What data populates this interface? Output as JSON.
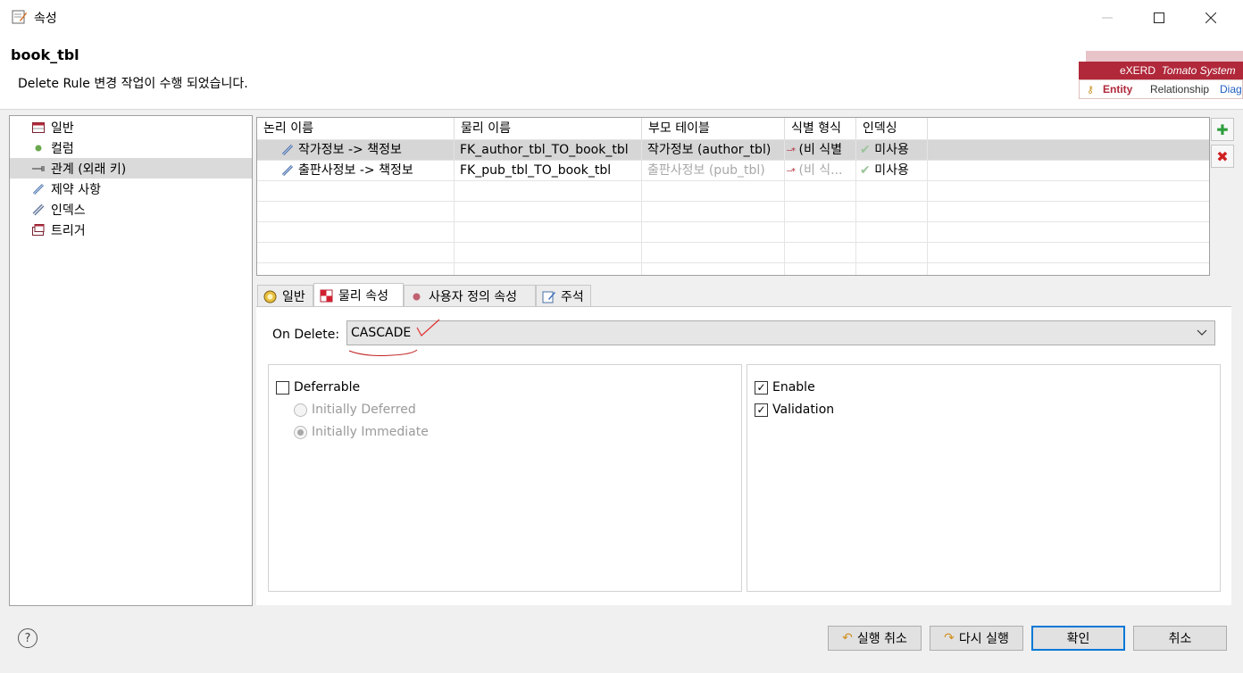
{
  "window": {
    "title": "속성"
  },
  "header": {
    "title": "book_tbl",
    "message": "Delete Rule 변경 작업이 수행 되었습니다."
  },
  "logo": {
    "brand": "eXERD",
    "product": "Tomato System",
    "tabs": [
      "Entity",
      "Relationship",
      "Diag"
    ]
  },
  "nav": {
    "items": [
      {
        "label": "일반",
        "icon": "table-icon"
      },
      {
        "label": "컬럼",
        "icon": "column-dot-icon"
      },
      {
        "label": "관계 (외래 키)",
        "icon": "relation-arrow-icon",
        "selected": true
      },
      {
        "label": "제약 사항",
        "icon": "constraint-icon"
      },
      {
        "label": "인덱스",
        "icon": "index-icon"
      },
      {
        "label": "트리거",
        "icon": "trigger-icon"
      }
    ]
  },
  "table": {
    "headers": [
      "논리 이름",
      "물리 이름",
      "부모 테이블",
      "식별 형식",
      "인덱싱"
    ],
    "rows": [
      {
        "logical": "작가정보 -> 책정보",
        "physical": "FK_author_tbl_TO_book_tbl",
        "parent": "작가정보 (author_tbl)",
        "ident": "(비 식별",
        "indexing": "미사용",
        "selected": true
      },
      {
        "logical": "출판사정보 -> 책정보",
        "physical": "FK_pub_tbl_TO_book_tbl",
        "parent": "출판사정보 (pub_tbl)",
        "ident": "(비 식...",
        "indexing": "미사용",
        "selected": false
      }
    ]
  },
  "tabs": [
    {
      "label": "일반",
      "icon": "general-icon"
    },
    {
      "label": "물리 속성",
      "icon": "physical-icon",
      "active": true
    },
    {
      "label": "사용자 정의 속성",
      "icon": "user-prop-icon"
    },
    {
      "label": "주석",
      "icon": "comment-icon"
    }
  ],
  "physical": {
    "on_delete_label": "On Delete:",
    "on_delete_value": "CASCADE",
    "deferrable": {
      "label": "Deferrable",
      "checked": false
    },
    "initially_deferred": {
      "label": "Initially Deferred",
      "selected": false
    },
    "initially_immediate": {
      "label": "Initially Immediate",
      "selected": true
    },
    "enable": {
      "label": "Enable",
      "checked": true
    },
    "validation": {
      "label": "Validation",
      "checked": true
    }
  },
  "footer": {
    "undo": "실행 취소",
    "redo": "다시 실행",
    "ok": "확인",
    "cancel": "취소"
  },
  "colors": {
    "accent": "#0078d7",
    "logo_red": "#b0283a",
    "add_green": "#2e9e3c",
    "delete_red": "#d02020"
  }
}
